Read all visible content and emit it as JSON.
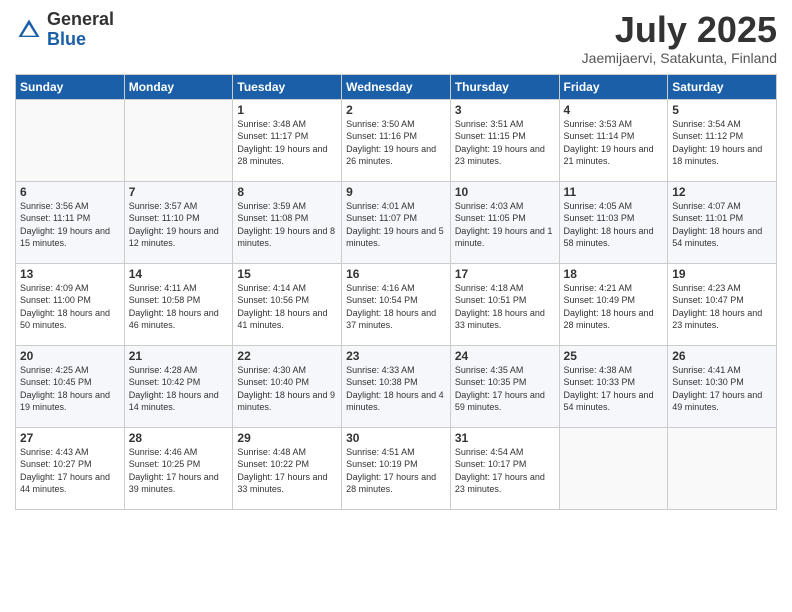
{
  "logo": {
    "general": "General",
    "blue": "Blue"
  },
  "title": "July 2025",
  "subtitle": "Jaemijaervi, Satakunta, Finland",
  "days_of_week": [
    "Sunday",
    "Monday",
    "Tuesday",
    "Wednesday",
    "Thursday",
    "Friday",
    "Saturday"
  ],
  "weeks": [
    [
      {
        "day": "",
        "info": ""
      },
      {
        "day": "",
        "info": ""
      },
      {
        "day": "1",
        "info": "Sunrise: 3:48 AM\nSunset: 11:17 PM\nDaylight: 19 hours and 28 minutes."
      },
      {
        "day": "2",
        "info": "Sunrise: 3:50 AM\nSunset: 11:16 PM\nDaylight: 19 hours and 26 minutes."
      },
      {
        "day": "3",
        "info": "Sunrise: 3:51 AM\nSunset: 11:15 PM\nDaylight: 19 hours and 23 minutes."
      },
      {
        "day": "4",
        "info": "Sunrise: 3:53 AM\nSunset: 11:14 PM\nDaylight: 19 hours and 21 minutes."
      },
      {
        "day": "5",
        "info": "Sunrise: 3:54 AM\nSunset: 11:12 PM\nDaylight: 19 hours and 18 minutes."
      }
    ],
    [
      {
        "day": "6",
        "info": "Sunrise: 3:56 AM\nSunset: 11:11 PM\nDaylight: 19 hours and 15 minutes."
      },
      {
        "day": "7",
        "info": "Sunrise: 3:57 AM\nSunset: 11:10 PM\nDaylight: 19 hours and 12 minutes."
      },
      {
        "day": "8",
        "info": "Sunrise: 3:59 AM\nSunset: 11:08 PM\nDaylight: 19 hours and 8 minutes."
      },
      {
        "day": "9",
        "info": "Sunrise: 4:01 AM\nSunset: 11:07 PM\nDaylight: 19 hours and 5 minutes."
      },
      {
        "day": "10",
        "info": "Sunrise: 4:03 AM\nSunset: 11:05 PM\nDaylight: 19 hours and 1 minute."
      },
      {
        "day": "11",
        "info": "Sunrise: 4:05 AM\nSunset: 11:03 PM\nDaylight: 18 hours and 58 minutes."
      },
      {
        "day": "12",
        "info": "Sunrise: 4:07 AM\nSunset: 11:01 PM\nDaylight: 18 hours and 54 minutes."
      }
    ],
    [
      {
        "day": "13",
        "info": "Sunrise: 4:09 AM\nSunset: 11:00 PM\nDaylight: 18 hours and 50 minutes."
      },
      {
        "day": "14",
        "info": "Sunrise: 4:11 AM\nSunset: 10:58 PM\nDaylight: 18 hours and 46 minutes."
      },
      {
        "day": "15",
        "info": "Sunrise: 4:14 AM\nSunset: 10:56 PM\nDaylight: 18 hours and 41 minutes."
      },
      {
        "day": "16",
        "info": "Sunrise: 4:16 AM\nSunset: 10:54 PM\nDaylight: 18 hours and 37 minutes."
      },
      {
        "day": "17",
        "info": "Sunrise: 4:18 AM\nSunset: 10:51 PM\nDaylight: 18 hours and 33 minutes."
      },
      {
        "day": "18",
        "info": "Sunrise: 4:21 AM\nSunset: 10:49 PM\nDaylight: 18 hours and 28 minutes."
      },
      {
        "day": "19",
        "info": "Sunrise: 4:23 AM\nSunset: 10:47 PM\nDaylight: 18 hours and 23 minutes."
      }
    ],
    [
      {
        "day": "20",
        "info": "Sunrise: 4:25 AM\nSunset: 10:45 PM\nDaylight: 18 hours and 19 minutes."
      },
      {
        "day": "21",
        "info": "Sunrise: 4:28 AM\nSunset: 10:42 PM\nDaylight: 18 hours and 14 minutes."
      },
      {
        "day": "22",
        "info": "Sunrise: 4:30 AM\nSunset: 10:40 PM\nDaylight: 18 hours and 9 minutes."
      },
      {
        "day": "23",
        "info": "Sunrise: 4:33 AM\nSunset: 10:38 PM\nDaylight: 18 hours and 4 minutes."
      },
      {
        "day": "24",
        "info": "Sunrise: 4:35 AM\nSunset: 10:35 PM\nDaylight: 17 hours and 59 minutes."
      },
      {
        "day": "25",
        "info": "Sunrise: 4:38 AM\nSunset: 10:33 PM\nDaylight: 17 hours and 54 minutes."
      },
      {
        "day": "26",
        "info": "Sunrise: 4:41 AM\nSunset: 10:30 PM\nDaylight: 17 hours and 49 minutes."
      }
    ],
    [
      {
        "day": "27",
        "info": "Sunrise: 4:43 AM\nSunset: 10:27 PM\nDaylight: 17 hours and 44 minutes."
      },
      {
        "day": "28",
        "info": "Sunrise: 4:46 AM\nSunset: 10:25 PM\nDaylight: 17 hours and 39 minutes."
      },
      {
        "day": "29",
        "info": "Sunrise: 4:48 AM\nSunset: 10:22 PM\nDaylight: 17 hours and 33 minutes."
      },
      {
        "day": "30",
        "info": "Sunrise: 4:51 AM\nSunset: 10:19 PM\nDaylight: 17 hours and 28 minutes."
      },
      {
        "day": "31",
        "info": "Sunrise: 4:54 AM\nSunset: 10:17 PM\nDaylight: 17 hours and 23 minutes."
      },
      {
        "day": "",
        "info": ""
      },
      {
        "day": "",
        "info": ""
      }
    ]
  ]
}
